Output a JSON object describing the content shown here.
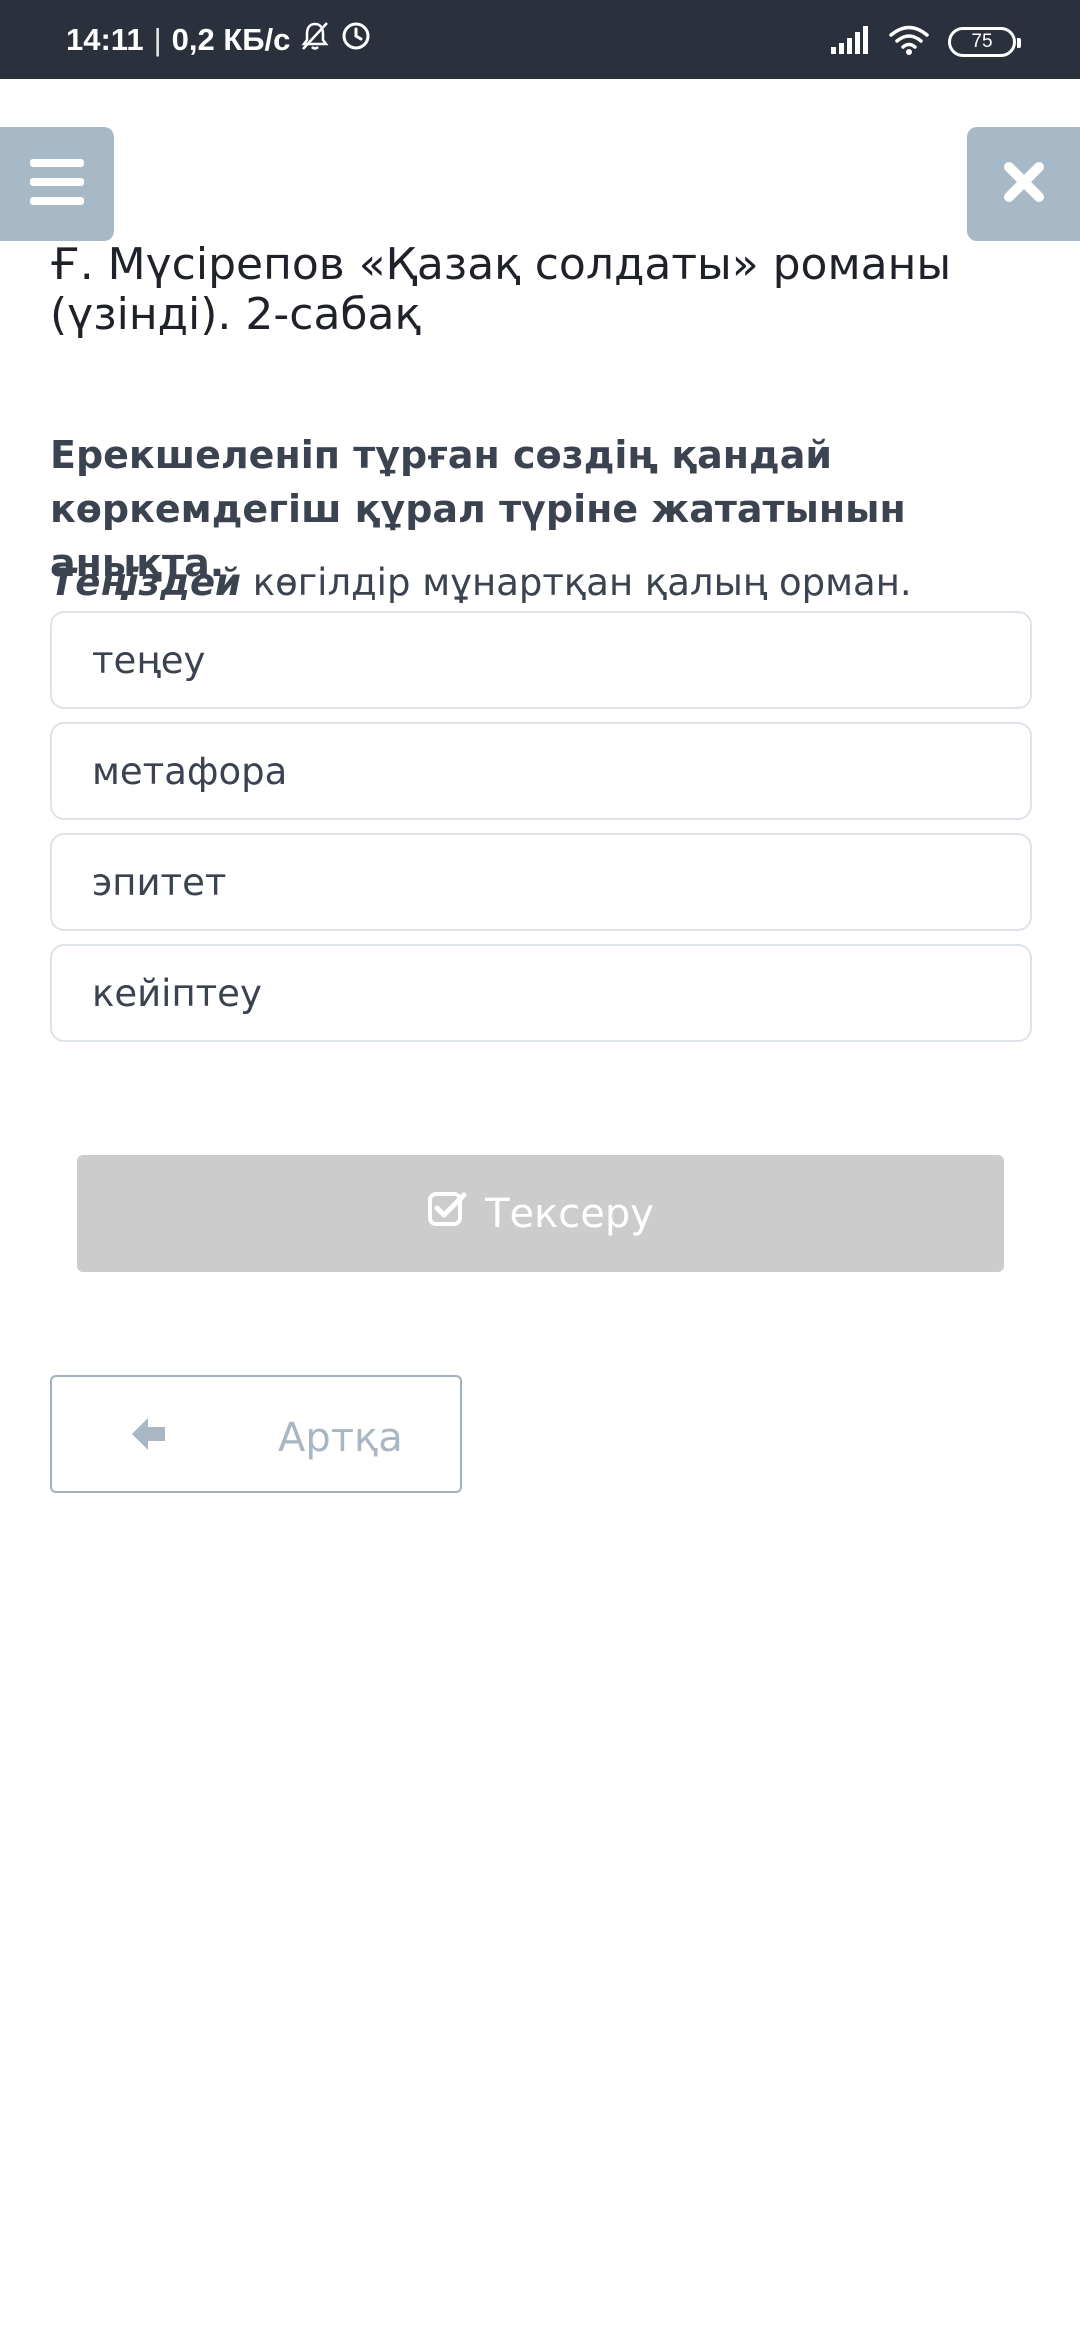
{
  "status_bar": {
    "time": "14:11",
    "separator": "|",
    "speed": "0,2 КБ/с",
    "battery": "75"
  },
  "header": {
    "menu_icon": "hamburger-menu-icon",
    "close_icon": "close-x-icon",
    "title": "Ғ. Мүсірепов «Қазақ солдаты» романы (үзінді). 2-сабақ"
  },
  "question": {
    "prompt": "Ерекшеленіп тұрған сөздің қандай көркемдегіш құрал түріне жататынын анықта.",
    "sentence_highlight": "Теңіздей",
    "sentence_rest": " көгілдір мұнартқан қалың орман."
  },
  "options": [
    {
      "label": "теңеу"
    },
    {
      "label": "метафора"
    },
    {
      "label": "эпитет"
    },
    {
      "label": "кейіптеу"
    }
  ],
  "actions": {
    "check_label": "Тексеру",
    "back_label": "Артқа"
  },
  "colors": {
    "status_bar_bg": "#2b303d",
    "nav_button_bg": "#a7b9c6",
    "check_button_bg": "#cccccc",
    "text": "#3b4350"
  }
}
